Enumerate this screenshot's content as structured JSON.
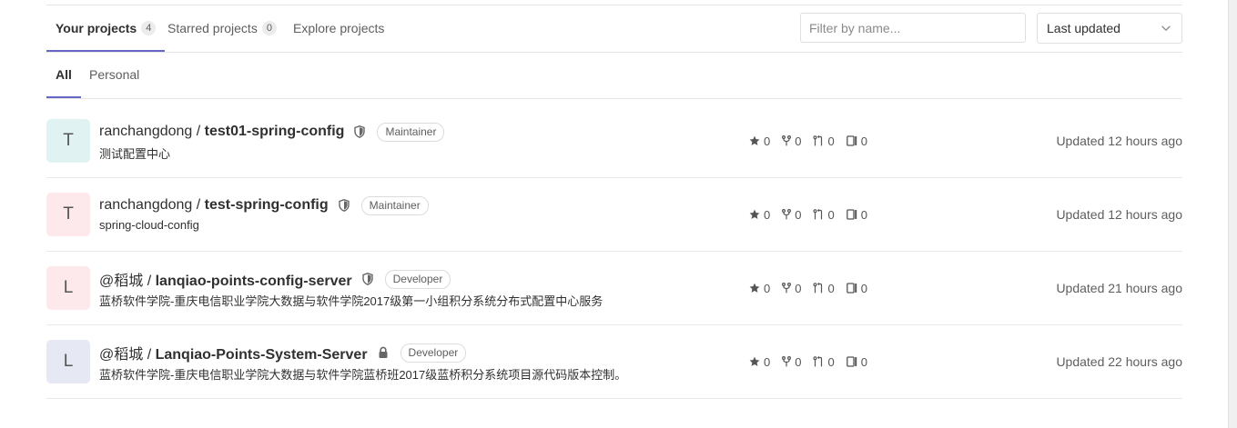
{
  "tabs": {
    "yours": {
      "label": "Your projects",
      "count": "4"
    },
    "starred": {
      "label": "Starred projects",
      "count": "0"
    },
    "explore": {
      "label": "Explore projects"
    }
  },
  "filter": {
    "placeholder": "Filter by name..."
  },
  "sort": {
    "selected": "Last updated"
  },
  "sub_tabs": {
    "all": "All",
    "personal": "Personal"
  },
  "projects": [
    {
      "avatar_letter": "T",
      "avatar_color": "#e0f2f1",
      "namespace": "ranchangdong / ",
      "name": "test01-spring-config",
      "visibility_icon": "shield-icon",
      "role": "Maintainer",
      "description": "测试配置中心",
      "stars": "0",
      "forks": "0",
      "merge_requests": "0",
      "issues": "0",
      "updated": "Updated 12 hours ago"
    },
    {
      "avatar_letter": "T",
      "avatar_color": "#fde8ec",
      "namespace": "ranchangdong / ",
      "name": "test-spring-config",
      "visibility_icon": "shield-icon",
      "role": "Maintainer",
      "description": "spring-cloud-config",
      "stars": "0",
      "forks": "0",
      "merge_requests": "0",
      "issues": "0",
      "updated": "Updated 12 hours ago"
    },
    {
      "avatar_letter": "L",
      "avatar_color": "#fde8ec",
      "namespace": "@稻城 / ",
      "name": "lanqiao-points-config-server",
      "visibility_icon": "shield-icon",
      "role": "Developer",
      "description": "蓝桥软件学院-重庆电信职业学院大数据与软件学院2017级第一小组积分系统分布式配置中心服务",
      "stars": "0",
      "forks": "0",
      "merge_requests": "0",
      "issues": "0",
      "updated": "Updated 21 hours ago"
    },
    {
      "avatar_letter": "L",
      "avatar_color": "#e6e8f4",
      "namespace": "@稻城 / ",
      "name": "Lanqiao-Points-System-Server",
      "visibility_icon": "lock-icon",
      "role": "Developer",
      "description": "蓝桥软件学院-重庆电信职业学院大数据与软件学院蓝桥班2017级蓝桥积分系统项目源代码版本控制。",
      "stars": "0",
      "forks": "0",
      "merge_requests": "0",
      "issues": "0",
      "updated": "Updated 22 hours ago"
    }
  ]
}
